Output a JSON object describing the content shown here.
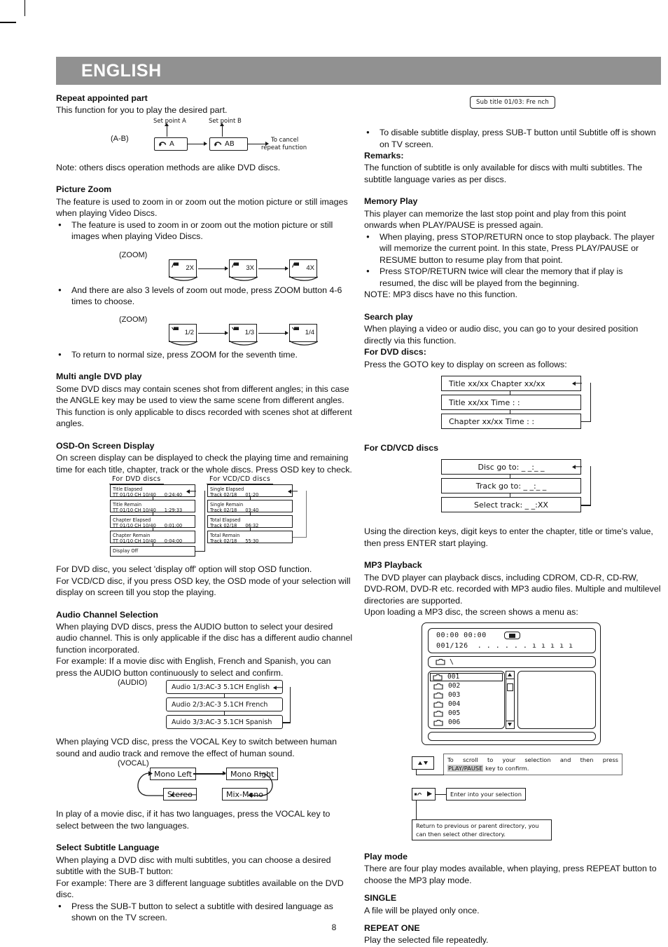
{
  "header": {
    "language": "ENGLISH"
  },
  "page_number": "8",
  "left": {
    "repeat_part": {
      "heading": "Repeat appointed part",
      "intro": "This function for you to play the desired part.",
      "diagram": {
        "label": "(A-B)",
        "cap_a": "Set point A",
        "cap_b": "Set point B",
        "box_a": "A",
        "box_ab": "AB",
        "cancel_line1": "To cancel",
        "cancel_line2": "repeat function",
        "icon": "repeat-loop-icon"
      },
      "note": "Note: others discs operation methods are alike DVD discs."
    },
    "picture_zoom": {
      "heading": "Picture Zoom",
      "intro": "The feature is used to zoom in or zoom out the motion picture or still images when playing Video Discs.",
      "bullet1": "The feature is used to zoom in or zoom out the motion picture or still images when playing Video Discs.",
      "zoom_in": {
        "label": "(ZOOM)",
        "steps": [
          "2X",
          "3X",
          "4X"
        ]
      },
      "bullet2": "And there are also 3 levels of zoom out mode, press ZOOM button 4-6 times to choose.",
      "zoom_out": {
        "label": "(ZOOM)",
        "steps": [
          "1/2",
          "1/3",
          "1/4"
        ]
      },
      "bullet3": "To return to normal size, press ZOOM for the seventh time."
    },
    "multi_angle": {
      "heading": "Multi angle DVD play",
      "para1": "Some DVD discs may contain scenes shot from different angles; in this case the ANGLE key may be used to view the same scene from different angles.",
      "para2": "This function is only applicable to discs recorded with scenes shot at different angles."
    },
    "osd": {
      "heading": "OSD-On Screen Display",
      "intro": "On screen display can be displayed to check the playing time and remaining time for each title, chapter, track or the whole discs. Press OSD key to check.",
      "dvd_header": "For DVD discs",
      "vcd_header": "For VCD/CD discs",
      "dvd_rows": [
        {
          "title": "Title Elapsed",
          "detail": "TT 01/10 CH 10/40",
          "time": "0:24:40"
        },
        {
          "title": "Title Remain",
          "detail": "TT 01/10 CH 10/40",
          "time": "1:29:33"
        },
        {
          "title": "Chapter Elapsed",
          "detail": "TT 01/10 CH 10/40",
          "time": "0:01:00"
        },
        {
          "title": "Chapter Remain",
          "detail": "TT 01/10 CH 10/40",
          "time": "0:04:00"
        },
        {
          "title": "Display Off",
          "detail": "",
          "time": ""
        }
      ],
      "vcd_rows": [
        {
          "title": "Single Elapsed",
          "detail": "Track 02/18",
          "time": "01:20"
        },
        {
          "title": "Single Remain",
          "detail": "Track 02/18",
          "time": "03:40"
        },
        {
          "title": "Total Elapsed",
          "detail": "Track 02/18",
          "time": "06:32"
        },
        {
          "title": "Total Remain",
          "detail": "Track 02/18",
          "time": "55:30"
        }
      ],
      "after1": "For DVD disc, you select 'display off' option will stop OSD function.",
      "after2": "For VCD/CD disc, if you press OSD key, the OSD mode of your selection will display on screen till you stop the playing."
    },
    "audio_channel": {
      "heading": "Audio Channel Selection",
      "para1": "When playing DVD discs, press the AUDIO button to select your desired audio channel. This is only applicable if the disc has a different audio channel function incorporated.",
      "para2": "For example: If a movie disc with English, French and Spanish, you can press the AUDIO button continuously to select and confirm.",
      "diagram_label": "(AUDIO)",
      "options": [
        "Audio 1/3:AC-3 5.1CH  English",
        "Audio 2/3:AC-3 5.1CH French",
        "Auido 3/3:AC-3 5.1CH  Spanish"
      ],
      "vocal_intro": "When playing VCD disc, press the VOCAL Key to switch between human sound and audio track and remove the effect of human sound.",
      "vocal_label": "(VOCAL)",
      "vocal_states": [
        "Mono Left",
        "Mono Right",
        "Mix-Mono",
        "Stereo"
      ],
      "vocal_after": "In play of a movie disc, if it has two languages, press the VOCAL key to select between the two languages."
    },
    "subtitle": {
      "heading": "Select Subtitle Language",
      "para1": "When playing a DVD disc with multi subtitles, you can choose a desired subtitle with the SUB-T button:",
      "para2": "For example: There are 3 different language subtitles available on the DVD disc.",
      "bullet1": "Press the SUB-T button to select a subtitle with desired language as shown on the TV screen."
    }
  },
  "right": {
    "subtitle_pill": "Sub title 01/03: Fre nch",
    "subtitle_bullet": "To disable subtitle display, press SUB-T button until Subtitle off is shown on TV screen.",
    "remarks": {
      "heading": "Remarks:",
      "body": "The function of subtitle is only available for discs with multi subtitles. The subtitle language varies as per discs."
    },
    "memory_play": {
      "heading": "Memory Play",
      "intro": "This player can memorize the last stop point and play from this point onwards when PLAY/PAUSE is pressed again.",
      "bullet1": "When playing, press STOP/RETURN once to stop playback. The player will memorize the current point. In this state, Press PLAY/PAUSE or RESUME button to resume play from that point.",
      "bullet2": "Press STOP/RETURN twice will clear the memory that if play is resumed, the disc will be played from the beginning.",
      "note": "NOTE: MP3 discs have no this function."
    },
    "search_play": {
      "heading": "Search play",
      "intro": "When playing a video or audio disc, you can go to your desired position directly via this function.",
      "dvd_heading": "For DVD discs:",
      "dvd_sub": "Press the GOTO key to display on screen as follows:",
      "dvd_rows": [
        "Title  xx/xx     Chapter xx/xx",
        "Title  xx/xx    Time     :     :",
        "Chapter  xx/xx      Time     :     :"
      ],
      "cd_heading": "For CD/VCD discs",
      "cd_rows": [
        "Disc go to:  _ _:_ _",
        "Track go to: _ _:_ _",
        "Select track: _ _:XX"
      ],
      "after": "Using the direction keys, digit keys to enter the chapter, title or time's value, then press ENTER start playing."
    },
    "mp3": {
      "heading": "MP3 Playback",
      "para1": "The DVD player can playback discs, including CDROM, CD-R, CD-RW, DVD-ROM, DVD-R etc. recorded with MP3 audio files. Multiple and multilevel directories are supported.",
      "para2": "Upon loading a MP3 disc, the screen shows a menu as:",
      "menu": {
        "time": "00:00  00:00",
        "counter": "001/126",
        "meter": ". . . . . . ı ı ı ı ı",
        "path": "\\",
        "stop_icon": "stop-icon",
        "folders": [
          "001",
          "002",
          "003",
          "004",
          "005",
          "006"
        ],
        "selected_folder": "001"
      },
      "legend": [
        {
          "key": "up-down-arrows-icon",
          "text_before": "To  scroll  to  your  selection  and  then  press",
          "text_highlight": "PLAY/PAUSE",
          "text_after": "key to confirm."
        },
        {
          "key": "left-right-arrow-icon",
          "text": "Enter into your selection"
        },
        {
          "key": "",
          "text": "Return to previous or parent directory, you can then select other directory."
        }
      ]
    },
    "play_mode": {
      "heading": "Play mode",
      "body": "There are four play modes available, when playing, press REPEAT button to choose the MP3 play mode.",
      "single_heading": "SINGLE",
      "single_body": "A file will be played only once.",
      "repeat_heading": "REPEAT ONE",
      "repeat_body": "Play the selected file repeatedly."
    }
  }
}
